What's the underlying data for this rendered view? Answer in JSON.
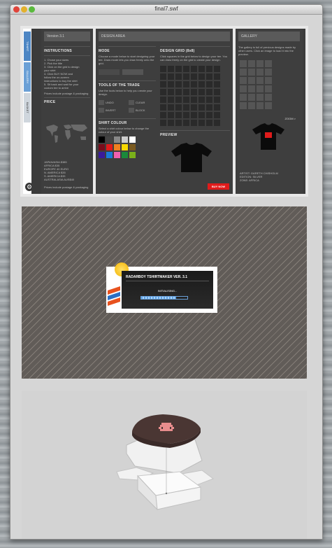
{
  "window": {
    "title": "final7.swf"
  },
  "tabs": [
    "TSHIRT",
    "GALLERY",
    "BASKET"
  ],
  "col1": {
    "version": "Version 3.1",
    "instructions_heading": "INSTRUCTIONS",
    "instructions": [
      "1. Chose your sizes",
      "2. Pick the title",
      "3. Click on the grid to design",
      "your shirt",
      "4. Click BUY NOW and",
      "follow the on-screen",
      "instructions to buy the shirt",
      "5. Sit back and wait for your",
      "custom tee to arrive"
    ],
    "instructions_note": "Prices include postage & packaging",
    "price_heading": "PRICE",
    "prices": [
      "JAPAN/ASIA $385",
      "AFRICA $35",
      "EUROPE 40 EURO",
      "N. AMERICA $35",
      "S. AMERICA $35",
      "AUSTRALASIA AUS$40"
    ],
    "price_note": "Prices include postage & packaging"
  },
  "col2": {
    "header": "DESIGN AREA",
    "mode_heading": "MODE",
    "mode_text": "Choose a mode below to start designing your tee. Draw mode lets you draw freely onto the grid.",
    "tools_heading": "TOOLS OF THE TRADE",
    "tools_text": "Use the tools below to help you create your design.",
    "tools": [
      "UNDO",
      "CLEAR",
      "INVERT",
      "BLOCK"
    ],
    "colour_heading": "SHIRT COLOUR",
    "colour_text": "Select a shirt colour below to change the colour of your shirt.",
    "swatches": [
      "#000000",
      "#444444",
      "#888888",
      "#cccccc",
      "#ffffff",
      "#7a0c1b",
      "#e01b1b",
      "#f08020",
      "#f7d800",
      "#7a5a20",
      "#3a1b9a",
      "#1a7ad8",
      "#f060b0",
      "#1a8a3a",
      "#7ab01a"
    ],
    "grid_heading": "DESIGN GRID (8x8)",
    "grid_text": "Click squares in the grid below to design your tee. You can draw freely on the grid to create your design.",
    "preview_heading": "PREVIEW",
    "buy_label": "BUY NOW"
  },
  "col3": {
    "header": "GALLERY",
    "text": "The gallery is full of previous designs made by other users. Click an image to load it into the preview.",
    "zoom_label": "ZOOM >",
    "artist": "ARTIST: GARETH CHISHOLM",
    "edition": "EDITION: SILVER",
    "zone": "ZONE: AFRICA"
  },
  "loader": {
    "title": "RADARBOY TSHIRTMAKER VER. 3.1",
    "status": "INITIALISING...",
    "progress": 0.75
  }
}
